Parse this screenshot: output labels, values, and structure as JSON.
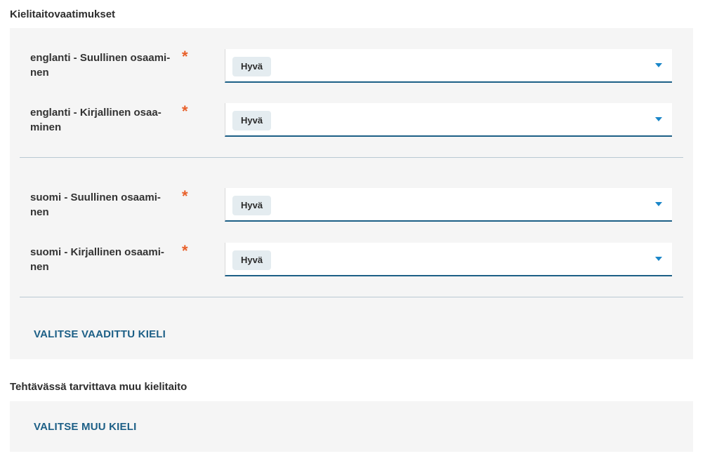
{
  "language_requirements": {
    "title": "Kielitaitovaatimukset",
    "groups": [
      {
        "rows": [
          {
            "label": "englanti - Suullinen osaami-nen",
            "label_line1": "englanti - Suullinen osaami-",
            "label_line2": "nen",
            "required_marker": "*",
            "value": "Hyvä"
          },
          {
            "label": "englanti - Kirjallinen osaa-minen",
            "label_line1": "englanti - Kirjallinen osaa-",
            "label_line2": "minen",
            "required_marker": "*",
            "value": "Hyvä"
          }
        ]
      },
      {
        "rows": [
          {
            "label": "suomi - Suullinen osaami-nen",
            "label_line1": "suomi - Suullinen osaami-",
            "label_line2": "nen",
            "required_marker": "*",
            "value": "Hyvä"
          },
          {
            "label": "suomi - Kirjallinen osaami-nen",
            "label_line1": "suomi - Kirjallinen osaami-",
            "label_line2": "nen",
            "required_marker": "*",
            "value": "Hyvä"
          }
        ]
      }
    ],
    "add_button_label": "VALITSE VAADITTU KIELI"
  },
  "other_language": {
    "title": "Tehtävässä tarvittava muu kielitaito",
    "add_button_label": "VALITSE MUU KIELI"
  },
  "colors": {
    "panel_bg": "#f5f5f5",
    "accent": "#1c5f86",
    "caret": "#1a86c8",
    "required": "#e8602a",
    "chip_bg": "#e4ecf0"
  },
  "icons": {
    "dropdown": "chevron-down-icon"
  }
}
